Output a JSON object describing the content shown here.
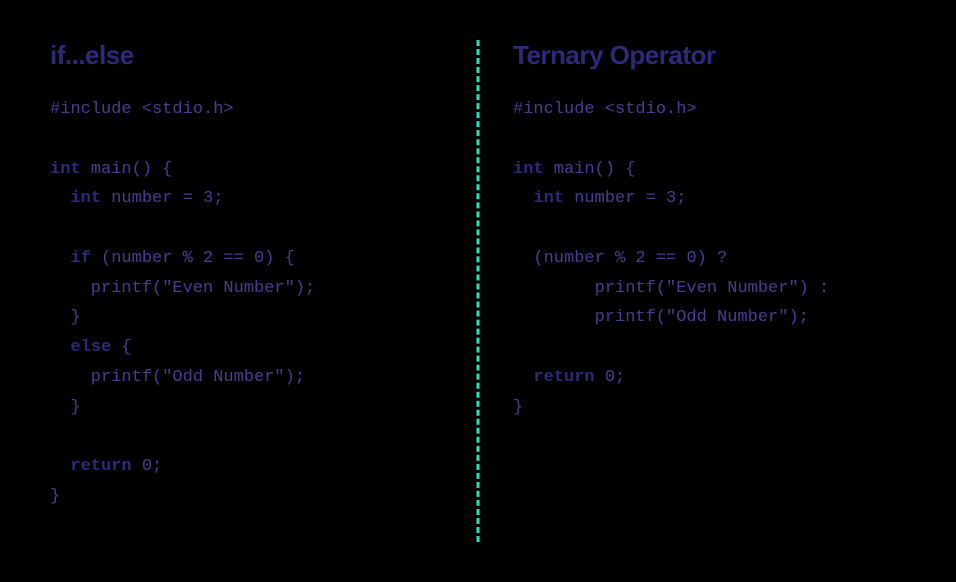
{
  "left": {
    "heading": "if...else",
    "code": {
      "line1": "#include <stdio.h>",
      "line2": "",
      "line3a": "int",
      "line3b": " main() {",
      "line4a": "  ",
      "line4b": "int",
      "line4c": " number = ",
      "line4d": "3",
      "line4e": ";",
      "line5": "",
      "line6a": "  ",
      "line6b": "if",
      "line6c": " (number % ",
      "line6d": "2",
      "line6e": " == ",
      "line6f": "0",
      "line6g": ") {",
      "line7a": "    printf(",
      "line7b": "\"Even Number\"",
      "line7c": ");",
      "line8": "  }",
      "line9a": "  ",
      "line9b": "else",
      "line9c": " {",
      "line10a": "    printf(",
      "line10b": "\"Odd Number\"",
      "line10c": ");",
      "line11": "  }",
      "line12": "",
      "line13a": "  ",
      "line13b": "return",
      "line13c": " ",
      "line13d": "0",
      "line13e": ";",
      "line14": "}"
    }
  },
  "right": {
    "heading": "Ternary Operator",
    "code": {
      "line1": "#include <stdio.h>",
      "line2": "",
      "line3a": "int",
      "line3b": " main() {",
      "line4a": "  ",
      "line4b": "int",
      "line4c": " number = ",
      "line4d": "3",
      "line4e": ";",
      "line5": "",
      "line6a": "  (number % ",
      "line6b": "2",
      "line6c": " == ",
      "line6d": "0",
      "line6e": ") ?",
      "line7a": "        printf(",
      "line7b": "\"Even Number\"",
      "line7c": ") :",
      "line8a": "        printf(",
      "line8b": "\"Odd Number\"",
      "line8c": ");",
      "line9": "",
      "line10a": "  ",
      "line10b": "return",
      "line10c": " ",
      "line10d": "0",
      "line10e": ";",
      "line11": "}"
    }
  }
}
